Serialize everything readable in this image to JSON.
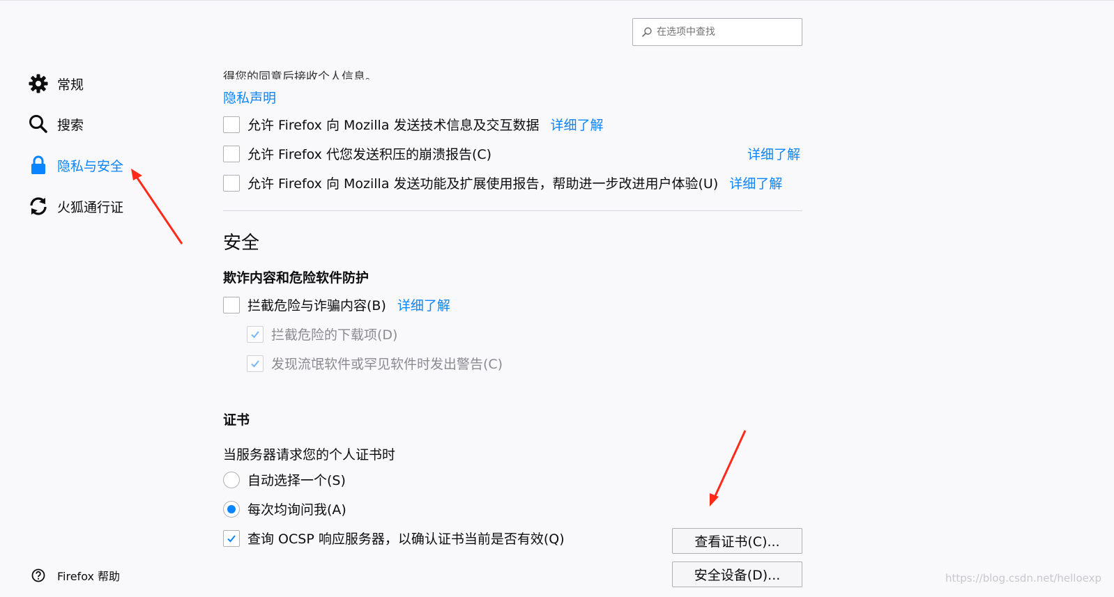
{
  "search": {
    "placeholder": "在选项中查找"
  },
  "sidebar": {
    "items": [
      {
        "label": "常规"
      },
      {
        "label": "搜索"
      },
      {
        "label": "隐私与安全"
      },
      {
        "label": "火狐通行证"
      }
    ],
    "help_label": "Firefox 帮助"
  },
  "data_collection": {
    "cut_text": "得您的同意后接收个人信息。",
    "privacy_link": "隐私声明",
    "options": [
      {
        "label": "允许 Firefox 向 Mozilla 发送技术信息及交互数据",
        "link": "详细了解",
        "checked": false
      },
      {
        "label": "允许 Firefox 代您发送积压的崩溃报告(C)",
        "link": "详细了解",
        "checked": false
      },
      {
        "label": "允许 Firefox 向 Mozilla 发送功能及扩展使用报告，帮助进一步改进用户体验(U)",
        "link": "详细了解",
        "checked": false
      }
    ]
  },
  "security": {
    "title": "安全",
    "fraud": {
      "title": "欺诈内容和危险软件防护",
      "block_label": "拦截危险与诈骗内容(B)",
      "block_link": "详细了解",
      "sub_options": [
        {
          "label": "拦截危险的下载项(D)",
          "checked": true
        },
        {
          "label": "发现流氓软件或罕见软件时发出警告(C)",
          "checked": true
        }
      ]
    },
    "certs": {
      "title": "证书",
      "description": "当服务器请求您的个人证书时",
      "radio_options": [
        {
          "label": "自动选择一个(S)",
          "selected": false
        },
        {
          "label": "每次均询问我(A)",
          "selected": true
        }
      ],
      "ocsp_label": "查询 OCSP 响应服务器，以确认证书当前是否有效(Q)",
      "view_certs_button": "查看证书(C)...",
      "security_devices_button": "安全设备(D)..."
    }
  },
  "watermark": "https://blog.csdn.net/helloexp",
  "colors": {
    "accent": "#0a84ff",
    "annotation_arrow": "#ff2a1a"
  }
}
